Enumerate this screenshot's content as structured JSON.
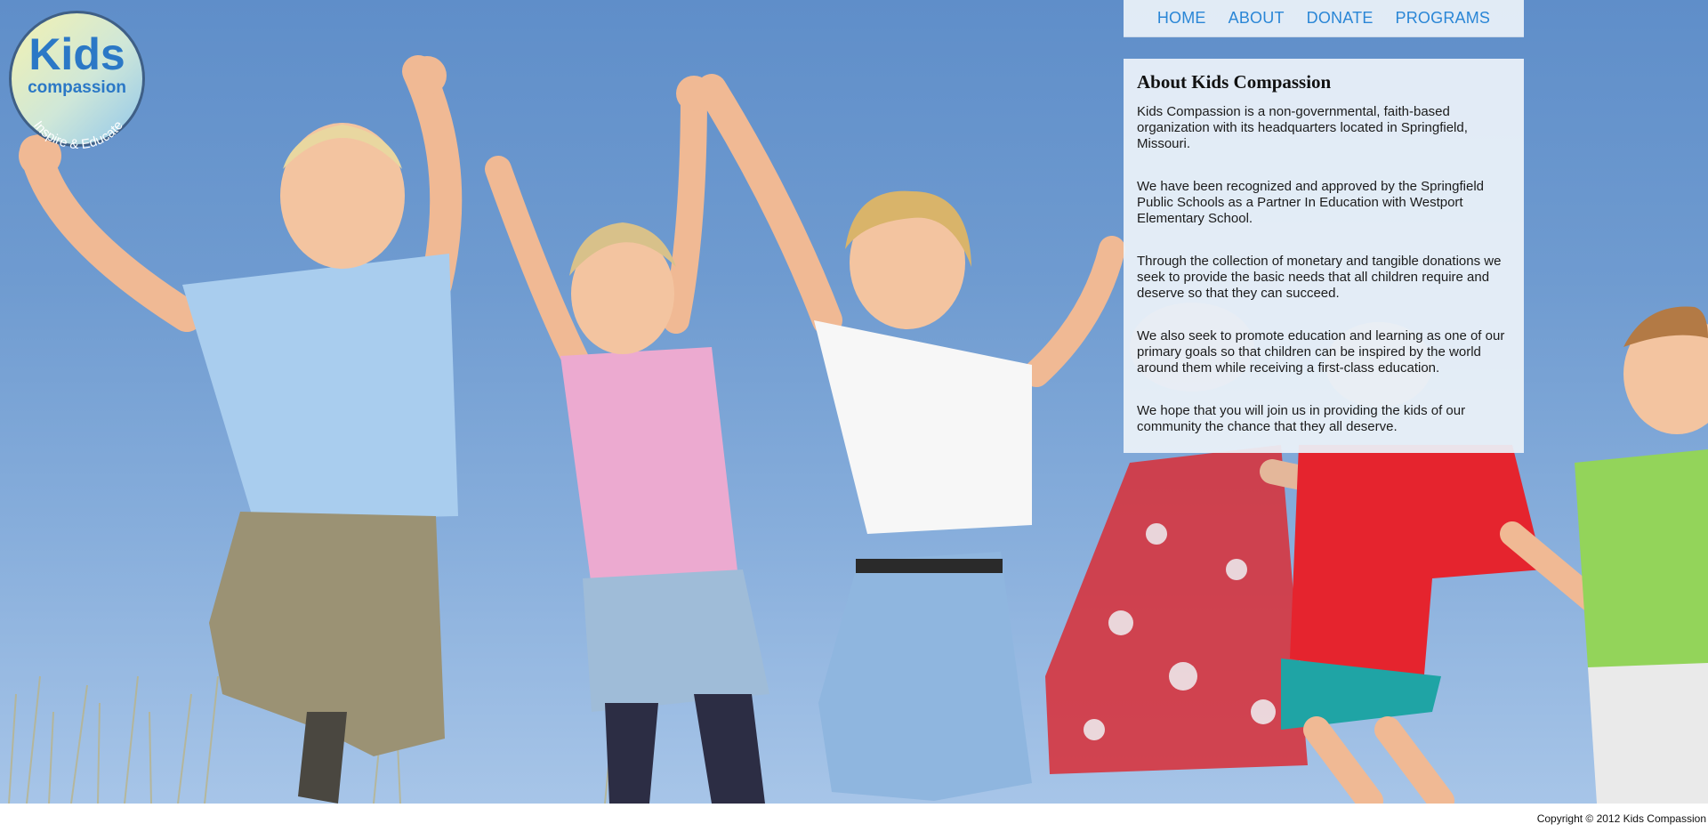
{
  "logo": {
    "word_kids": "Kids",
    "word_compassion": "compassion",
    "tagline": "Inspire & Educate"
  },
  "nav": {
    "items": [
      {
        "label": "HOME"
      },
      {
        "label": "ABOUT"
      },
      {
        "label": "DONATE"
      },
      {
        "label": "PROGRAMS"
      }
    ]
  },
  "about": {
    "title": "About Kids Compassion",
    "paragraphs": [
      "Kids Compassion is a non-governmental, faith-based organization with its headquarters located in Springfield, Missouri.",
      "We have been recognized and approved by the Springfield Public Schools as a Partner In Education with Westport Elementary School.",
      "Through the collection of monetary and tangible donations we seek to provide the basic needs that all children require and deserve so that they can succeed.",
      "We also seek to promote education and learning as one of our primary goals so that children can be inspired by the world around them while receiving a first-class education.",
      "We hope that you will join us in providing the kids of our community the chance that they all deserve."
    ]
  },
  "footer": {
    "copyright": "Copyright © 2012 Kids Compassion"
  },
  "colors": {
    "nav_link": "#2a86d6",
    "sky": "#6f9bd0",
    "panel_bg": "#ecf2f9"
  }
}
